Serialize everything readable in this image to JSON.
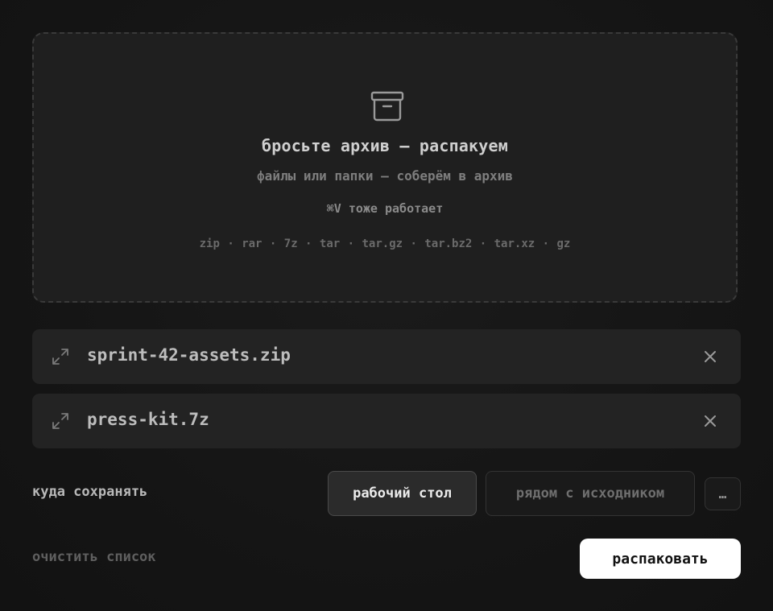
{
  "dropzone": {
    "icon": "archive-box-icon",
    "title": "бросьте архив — распакуем",
    "subtitle": "файлы или папки — соберём в архив",
    "hint": "⌘V тоже работает",
    "formats": "zip · rar · 7z · tar · tar.gz · tar.bz2 · tar.xz · gz"
  },
  "files": [
    {
      "name": "sprint-42-assets.zip",
      "icon": "expand-arrows-icon",
      "remove_icon": "close-icon"
    },
    {
      "name": "press-kit.7z",
      "icon": "expand-arrows-icon",
      "remove_icon": "close-icon"
    }
  ],
  "destination": {
    "label": "куда сохранять",
    "options": [
      "рабочий стол",
      "рядом с исходником"
    ],
    "selected": "рабочий стол",
    "more_label": "…"
  },
  "actions": {
    "clear_label": "очистить список",
    "extract_label": "распаковать"
  },
  "colors": {
    "background": "#161616",
    "panel": "#232323",
    "primary_button": "#ffffff"
  }
}
